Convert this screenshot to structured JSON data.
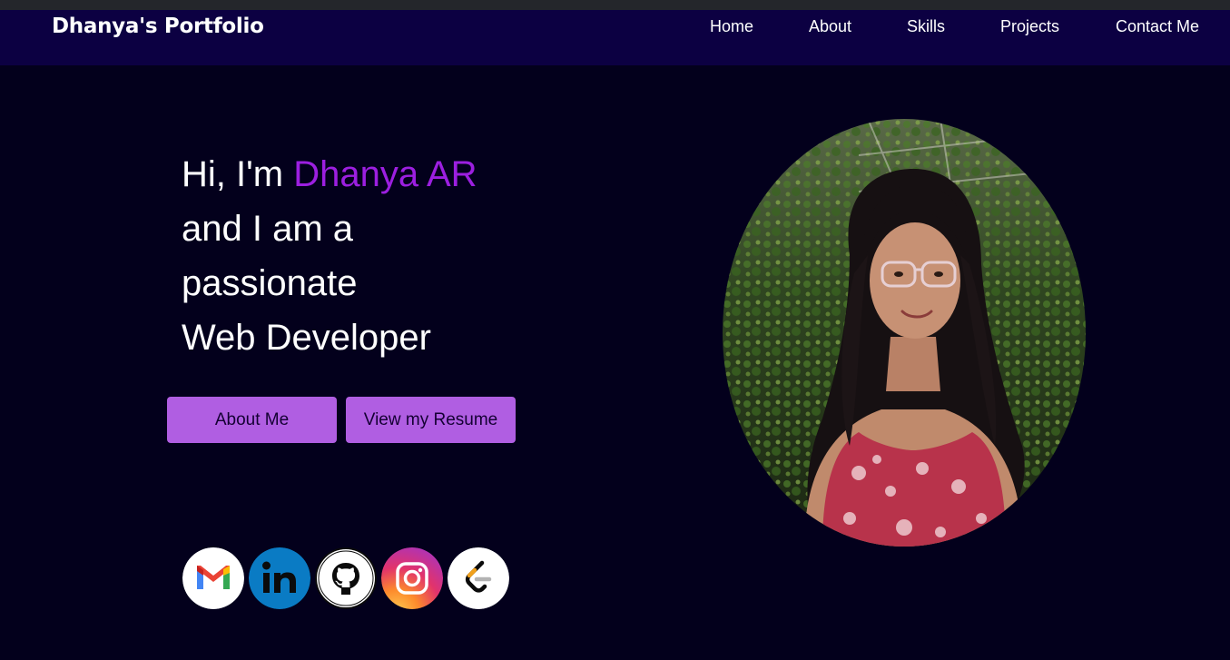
{
  "header": {
    "brand": "Dhanya's Portfolio",
    "nav": [
      {
        "label": "Home"
      },
      {
        "label": "About"
      },
      {
        "label": "Skills"
      },
      {
        "label": "Projects"
      },
      {
        "label": "Contact Me"
      }
    ]
  },
  "hero": {
    "greeting": "Hi, I'm ",
    "name": "Dhanya AR",
    "line2": "and I am a",
    "line3": "passionate",
    "line4": "Web Developer",
    "about_button": "About Me",
    "resume_button": "View my Resume"
  },
  "social": [
    {
      "icon": "gmail-icon"
    },
    {
      "icon": "linkedin-icon"
    },
    {
      "icon": "github-icon"
    },
    {
      "icon": "instagram-icon"
    },
    {
      "icon": "leetcode-icon"
    }
  ],
  "colors": {
    "background": "#03001c",
    "navbar": "#0c0042",
    "accent": "#9c1fe0",
    "button": "#b05ee2"
  }
}
